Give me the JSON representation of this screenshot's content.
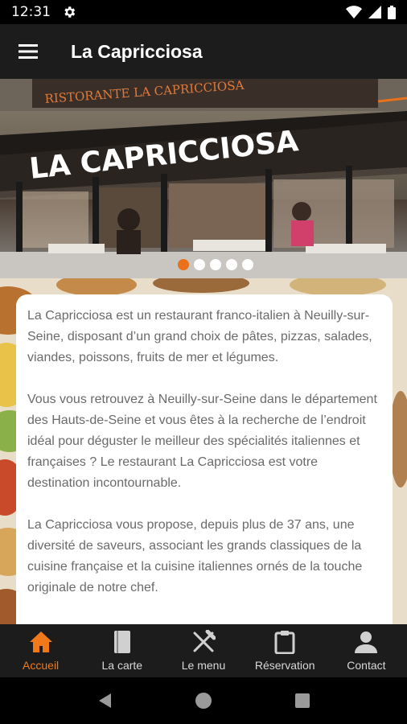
{
  "status_bar": {
    "time": "12:31"
  },
  "app_bar": {
    "title": "La Capricciosa"
  },
  "hero": {
    "awning_text": "LA CAPRICCIOSA",
    "sign_text": "RISTORANTE LA CAPRICCIOSA",
    "carousel": {
      "total": 5,
      "active_index": 0
    }
  },
  "content": {
    "paragraphs": [
      "La Capricciosa est un restaurant franco-italien à Neuilly-sur-Seine, disposant d’un grand choix de pâtes, pizzas, salades, viandes, poissons, fruits de mer et légumes.",
      "Vous vous retrouvez à Neuilly-sur-Seine dans le département des Hauts-de-Seine et vous êtes à la recherche de l’endroit idéal pour déguster le meilleur des spécialités italiennes et françaises ? Le restaurant La Capricciosa est votre destination incontournable.",
      "La Capricciosa vous propose, depuis plus de 37 ans, une diversité de saveurs, associant les grands classiques de la cuisine française et la cuisine italiennes ornés de la touche originale de notre chef."
    ]
  },
  "bottom_nav": {
    "items": [
      {
        "label": "Accueil",
        "icon": "home-icon",
        "active": true
      },
      {
        "label": "La carte",
        "icon": "book-icon",
        "active": false
      },
      {
        "label": "Le menu",
        "icon": "fork-knife-icon",
        "active": false
      },
      {
        "label": "Réservation",
        "icon": "clipboard-icon",
        "active": false
      },
      {
        "label": "Contact",
        "icon": "person-icon",
        "active": false
      }
    ]
  },
  "colors": {
    "accent": "#f07a1a",
    "app_bar": "#1c1c1c",
    "text": "#6a6a6a"
  }
}
